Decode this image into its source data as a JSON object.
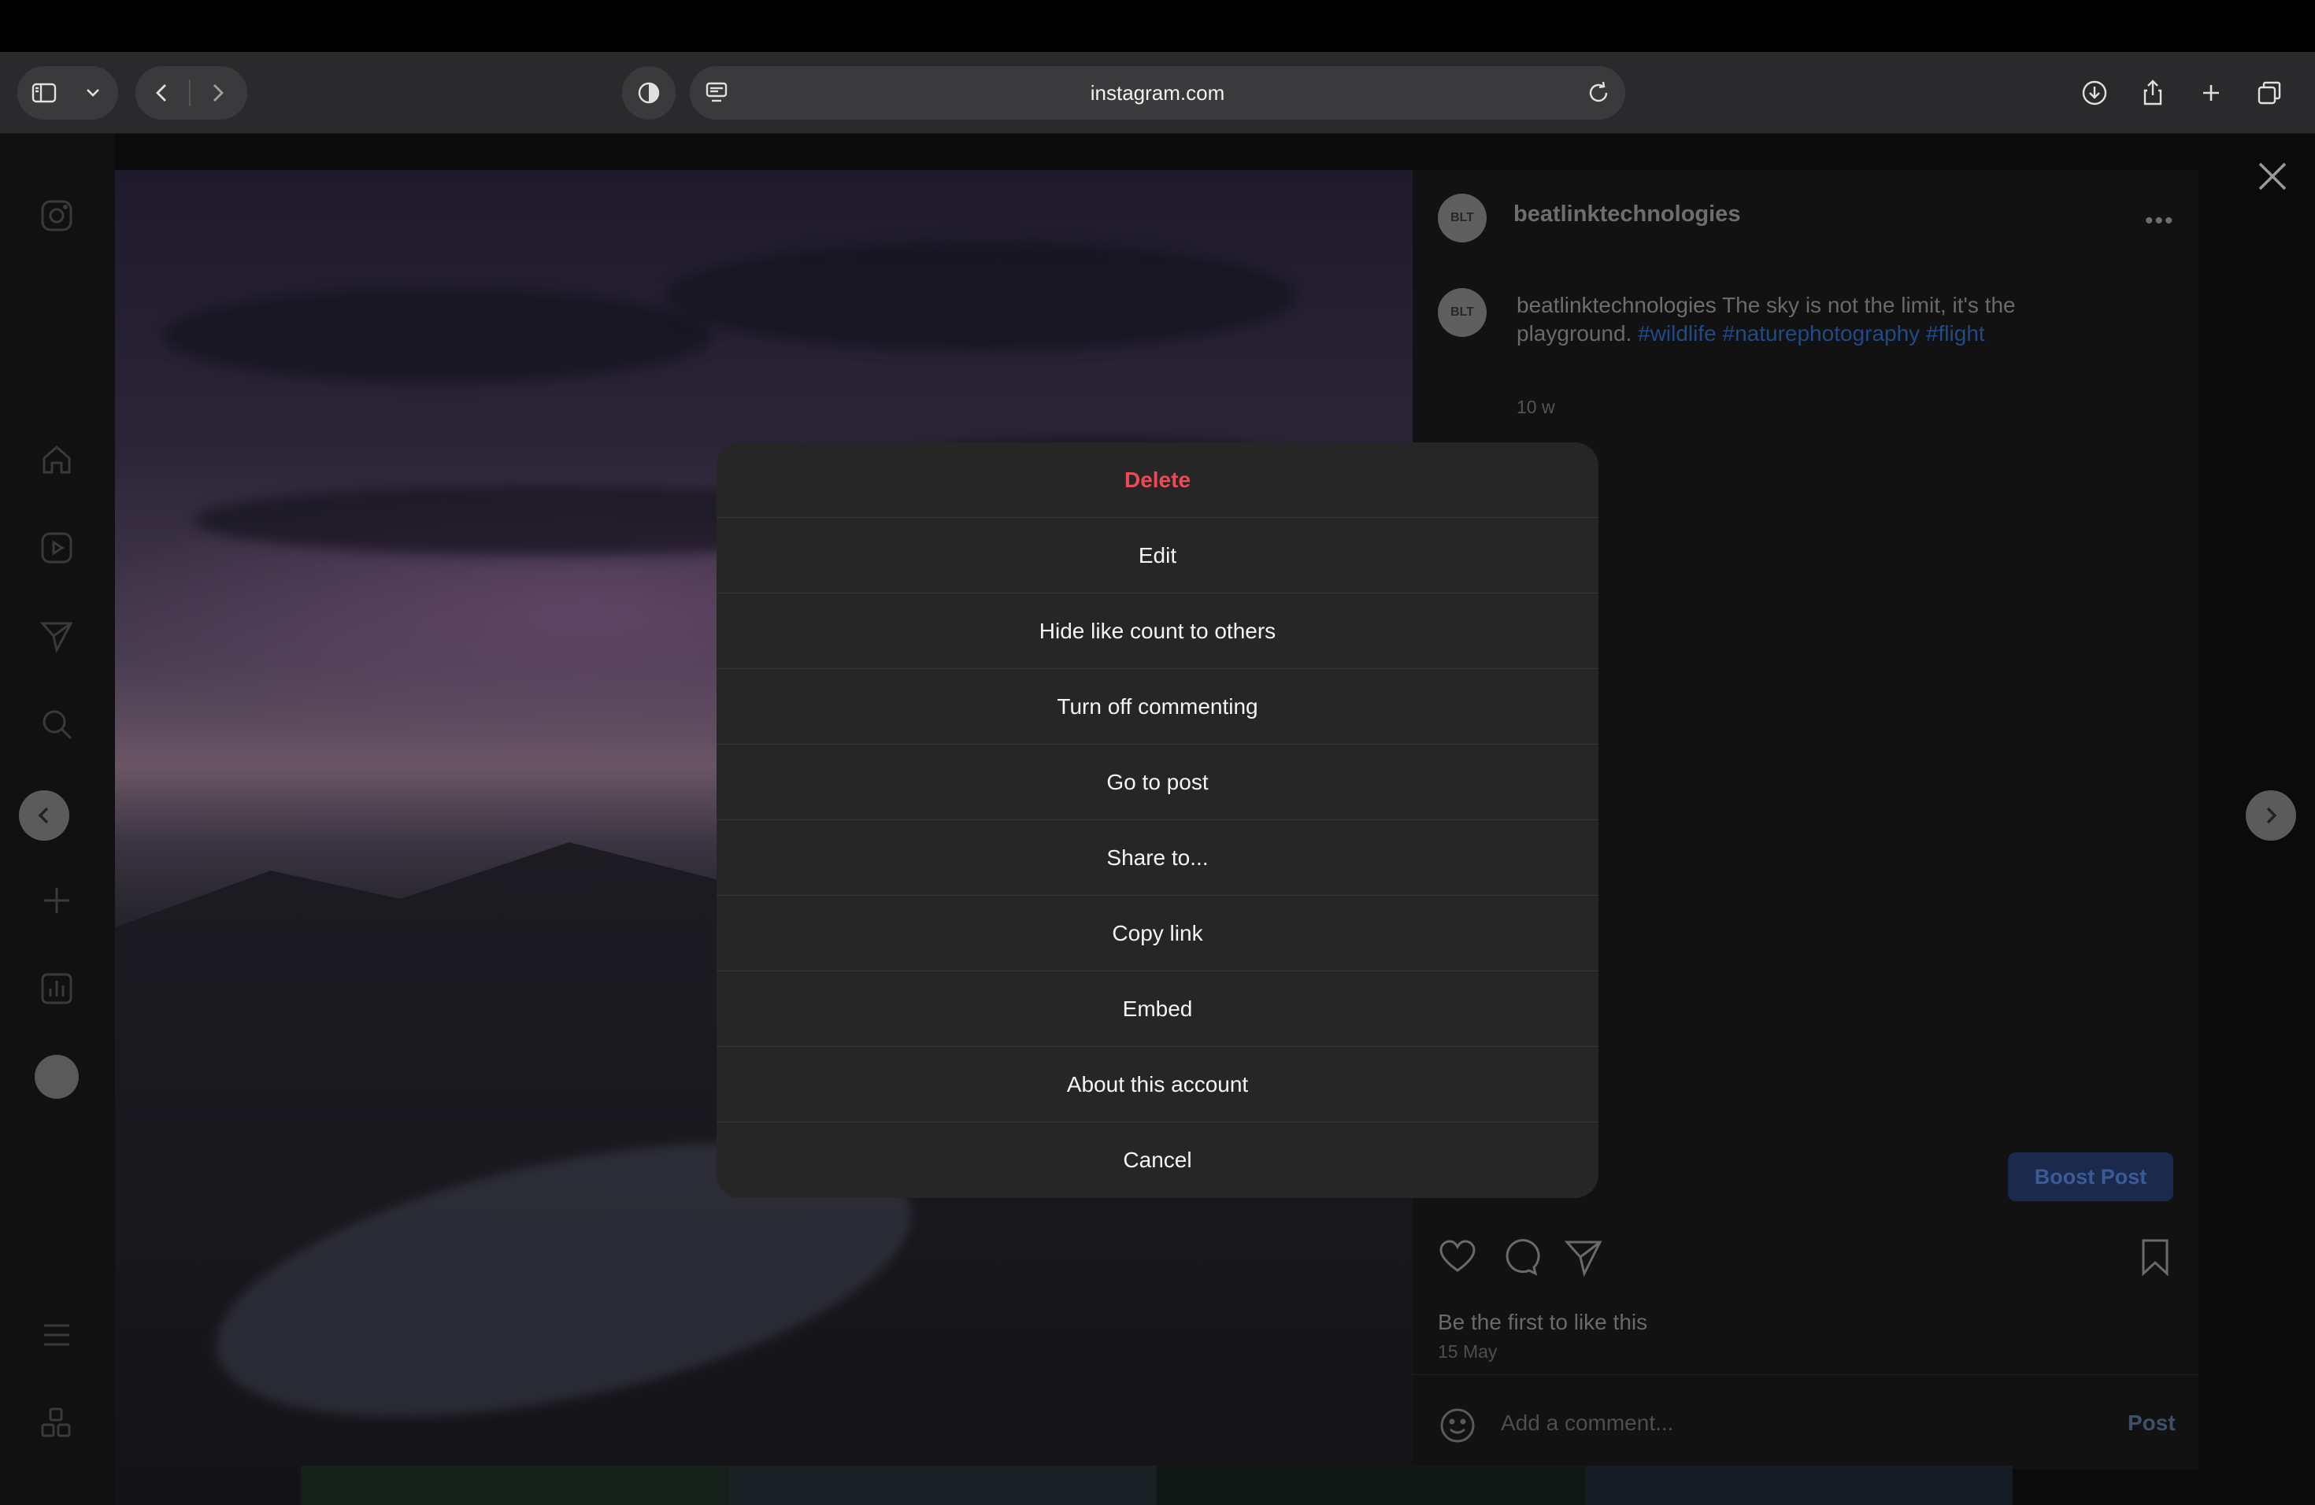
{
  "browser": {
    "url": "instagram.com"
  },
  "post": {
    "username": "beatlinktechnologies",
    "avatar_text": "BLT",
    "caption_user": "beatlinktechnologies",
    "caption_text": " The sky is not the limit, it's the playground.",
    "hashtags": [
      "#wildlife",
      "#naturephotography",
      "#flight"
    ],
    "age": "10 w",
    "boost_label": "Boost Post",
    "likes_text": "Be the first to like this",
    "date": "15 May",
    "comment_placeholder": "Add a comment...",
    "post_label": "Post"
  },
  "modal": {
    "items": [
      {
        "label": "Delete",
        "danger": true
      },
      {
        "label": "Edit"
      },
      {
        "label": "Hide like count to others"
      },
      {
        "label": "Turn off commenting"
      },
      {
        "label": "Go to post"
      },
      {
        "label": "Share to..."
      },
      {
        "label": "Copy link"
      },
      {
        "label": "Embed"
      },
      {
        "label": "About this account"
      },
      {
        "label": "Cancel"
      }
    ]
  },
  "colors": {
    "danger": "#ed4956",
    "modal_bg": "#262626",
    "hashtag": "#1f4b86"
  }
}
